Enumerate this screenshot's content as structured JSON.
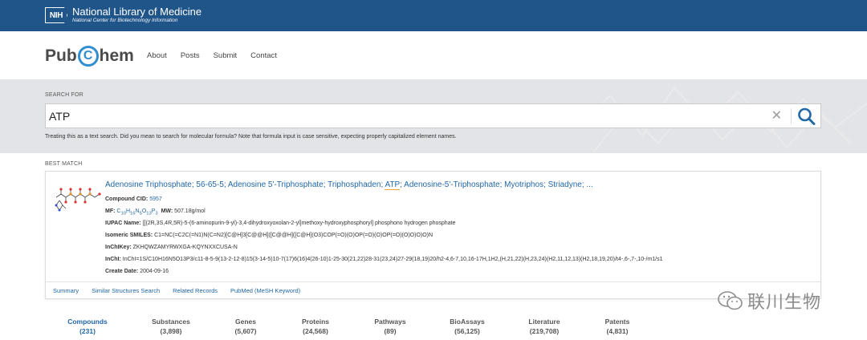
{
  "nih": {
    "badge": "NIH",
    "title": "National Library of Medicine",
    "subtitle": "National Center for Biotechnology Information"
  },
  "header": {
    "logo_left": "Pub",
    "logo_c": "C",
    "logo_right": "hem",
    "nav": [
      "About",
      "Posts",
      "Submit",
      "Contact"
    ]
  },
  "search": {
    "label": "SEARCH FOR",
    "value": "ATP",
    "note": "Treating this as a text search. Did you mean to search for molecular formula? Note that formula input is case sensitive, expecting properly capitalized element names."
  },
  "best_match": {
    "label": "BEST MATCH",
    "title_before": "Adenosine Triphosphate; 56-65-5; Adenosine 5'-Triphosphate; Triphosphaden; ",
    "title_highlight": "ATP",
    "title_after": "; Adenosine-5'-Triphosphate; Myotriphos; Striadyne; ...",
    "cid_label": "Compound CID:",
    "cid_value": "5957",
    "mf_label": "MF:",
    "mf_value": "C10H16N5O13P3",
    "mw_label": "MW:",
    "mw_value": "507.18g/mol",
    "iupac_label": "IUPAC Name:",
    "iupac_value": "[[(2R,3S,4R,5R)-5-(6-aminopurin-9-yl)-3,4-dihydroxyoxolan-2-yl]methoxy-hydroxyphosphoryl] phosphono hydrogen phosphate",
    "smiles_label": "Isomeric SMILES:",
    "smiles_value": "C1=NC(=C2C(=N1)N(C=N2)[C@H]3[C@@H]([C@@H]([C@H](O3)COP(=O)(O)OP(=O)(O)OP(=O)(O)O)O)O)N",
    "inchikey_label": "InChIKey:",
    "inchikey_value": "ZKHQWZAMYRWXGA-KQYNXXCUSA-N",
    "inchi_label": "InChI:",
    "inchi_value": "InChI=1S/C10H16N5O13P3/c11-8-5-9(13-2-12-8)15(3-14-5)10-7(17)6(16)4(26-10)1-25-30(21,22)28-31(23,24)27-29(18,19)20/h2-4,6-7,10,16-17H,1H2,(H,21,22)(H,23,24)(H2,11,12,13)(H2,18,19,20)/t4-,6-,7-,10-/m1/s1",
    "date_label": "Create Date:",
    "date_value": "2004-09-16",
    "links": [
      "Summary",
      "Similar Structures Search",
      "Related Records",
      "PubMed (MeSH Keyword)"
    ]
  },
  "categories": [
    {
      "name": "Compounds",
      "count": "(231)"
    },
    {
      "name": "Substances",
      "count": "(3,898)"
    },
    {
      "name": "Genes",
      "count": "(5,607)"
    },
    {
      "name": "Proteins",
      "count": "(24,568)"
    },
    {
      "name": "Pathways",
      "count": "(89)"
    },
    {
      "name": "BioAssays",
      "count": "(56,125)"
    },
    {
      "name": "Literature",
      "count": "(219,708)"
    },
    {
      "name": "Patents",
      "count": "(4,831)"
    }
  ],
  "watermark": "联川生物",
  "colors": {
    "nih_blue": "#20558a",
    "link_blue": "#2267a6",
    "logo_blue": "#2f8fd1",
    "search_bg": "#e3e4e8"
  }
}
